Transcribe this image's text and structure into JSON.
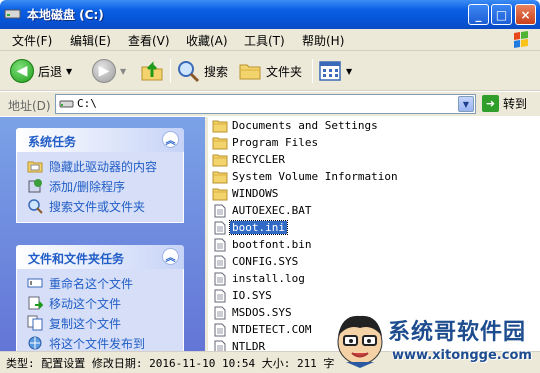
{
  "window": {
    "title": "本地磁盘 (C:)"
  },
  "title_buttons": {
    "minimize": "_",
    "maximize": "□",
    "close": "×"
  },
  "menu": [
    "文件(F)",
    "编辑(E)",
    "查看(V)",
    "收藏(A)",
    "工具(T)",
    "帮助(H)"
  ],
  "toolbar": {
    "back": "后退",
    "search": "搜索",
    "folders": "文件夹"
  },
  "address": {
    "label": "地址(D)",
    "value": "C:\\",
    "go": "转到"
  },
  "system_tasks": {
    "title": "系统任务",
    "items": [
      "隐藏此驱动器的内容",
      "添加/删除程序",
      "搜索文件或文件夹"
    ]
  },
  "file_tasks": {
    "title": "文件和文件夹任务",
    "items": [
      "重命名这个文件",
      "移动这个文件",
      "复制这个文件",
      "将这个文件发布到"
    ]
  },
  "files": [
    {
      "name": "Documents and Settings",
      "type": "folder"
    },
    {
      "name": "Program Files",
      "type": "folder"
    },
    {
      "name": "RECYCLER",
      "type": "folder"
    },
    {
      "name": "System Volume Information",
      "type": "folder"
    },
    {
      "name": "WINDOWS",
      "type": "folder"
    },
    {
      "name": "AUTOEXEC.BAT",
      "type": "file"
    },
    {
      "name": "boot.ini",
      "type": "file",
      "selected": true
    },
    {
      "name": "bootfont.bin",
      "type": "file"
    },
    {
      "name": "CONFIG.SYS",
      "type": "file"
    },
    {
      "name": "install.log",
      "type": "file"
    },
    {
      "name": "IO.SYS",
      "type": "file"
    },
    {
      "name": "MSDOS.SYS",
      "type": "file"
    },
    {
      "name": "NTDETECT.COM",
      "type": "file"
    },
    {
      "name": "NTLDR",
      "type": "file"
    }
  ],
  "status": "类型: 配置设置 修改日期: 2016-11-10 10:54 大小: 211 字",
  "watermark": {
    "title": "系统哥软件园",
    "url": "www.xitongge.com"
  },
  "colors": {
    "titlebar": "#0a5fe3",
    "taskpane": "#7ba2e7",
    "selection": "#316ac5",
    "link": "#215dc6"
  }
}
